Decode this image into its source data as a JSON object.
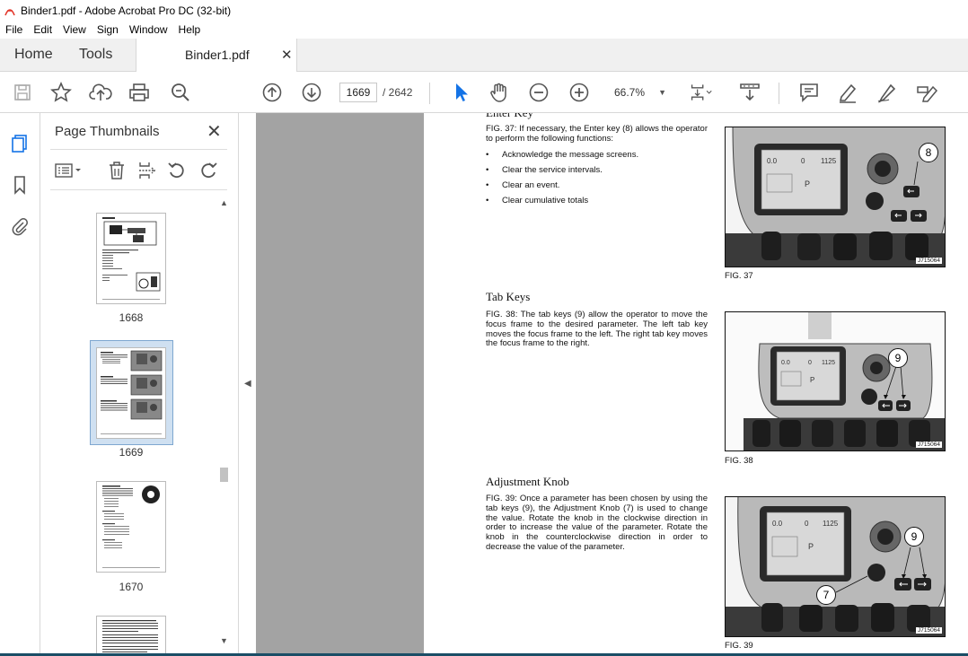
{
  "window": {
    "title": "Binder1.pdf - Adobe Acrobat Pro DC (32-bit)"
  },
  "menu": [
    "File",
    "Edit",
    "View",
    "Sign",
    "Window",
    "Help"
  ],
  "tabs": {
    "home": "Home",
    "tools": "Tools",
    "document": "Binder1.pdf"
  },
  "toolbar": {
    "current_page": "1669",
    "total_pages": "/ 2642",
    "zoom": "66.7%"
  },
  "panel": {
    "title": "Page Thumbnails",
    "thumbnails": [
      {
        "page": "1668"
      },
      {
        "page": "1669"
      },
      {
        "page": "1670"
      }
    ]
  },
  "document": {
    "partial_heading": "Enter Key",
    "sections": [
      {
        "paragraph": "FIG. 37: If necessary, the Enter key (8) allows the operator to perform the following functions:",
        "bullets": [
          "Acknowledge the message screens.",
          "Clear the service intervals.",
          "Clear an event.",
          "Clear cumulative totals"
        ],
        "caption": "FIG. 37",
        "callouts": [
          "8"
        ],
        "code": "J715064"
      },
      {
        "heading": "Tab Keys",
        "paragraph": "FIG. 38: The tab keys (9) allow the operator to move the focus frame to the desired parameter. The left tab key moves the focus frame to the left. The right tab key moves the focus frame to the right.",
        "caption": "FIG. 38",
        "callouts": [
          "9"
        ],
        "code": "J715064"
      },
      {
        "heading": "Adjustment Knob",
        "paragraph": "FIG. 39: Once a parameter has been chosen by using the tab keys (9), the Adjustment Knob (7) is used to change the value. Rotate the knob in the clockwise direction in order to increase the value of the parameter. Rotate the knob in the counterclockwise direction in order to decrease the value of the parameter.",
        "caption": "FIG. 39",
        "callouts": [
          "9",
          "7"
        ],
        "code": "J715064"
      }
    ]
  },
  "colors": {
    "accent": "#1473e6",
    "chrome": "#f0f0f0",
    "canvas": "#8c8c8c",
    "pdf_icon": "#e3372b"
  }
}
